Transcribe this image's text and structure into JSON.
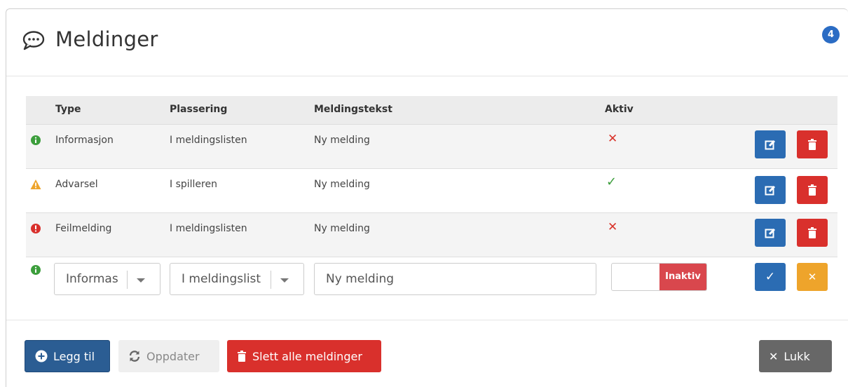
{
  "modal": {
    "title": "Meldinger",
    "badge_count": "4"
  },
  "table": {
    "headers": {
      "type": "Type",
      "placement": "Plassering",
      "text": "Meldingstekst",
      "active": "Aktiv"
    },
    "rows": [
      {
        "status": "info",
        "type": "Informasjon",
        "placement": "I meldingslisten",
        "text": "Ny melding",
        "active": false
      },
      {
        "status": "warning",
        "type": "Advarsel",
        "placement": "I spilleren",
        "text": "Ny melding",
        "active": true
      },
      {
        "status": "error",
        "type": "Feilmelding",
        "placement": "I meldingslisten",
        "text": "Ny melding",
        "active": false
      }
    ],
    "new_row": {
      "type_value": "Informas",
      "placement_value": "I meldingslist",
      "text_value": "Ny melding",
      "toggle_label": "Inaktiv"
    }
  },
  "footer": {
    "add_label": "Legg til",
    "refresh_label": "Oppdater",
    "delete_all_label": "Slett alle meldinger",
    "close_label": "Lukk"
  },
  "colors": {
    "primary": "#2b6cb3",
    "danger": "#d9302c",
    "warning": "#eea42b",
    "info": "#3c9e3c",
    "badge": "#2b6cc4"
  }
}
